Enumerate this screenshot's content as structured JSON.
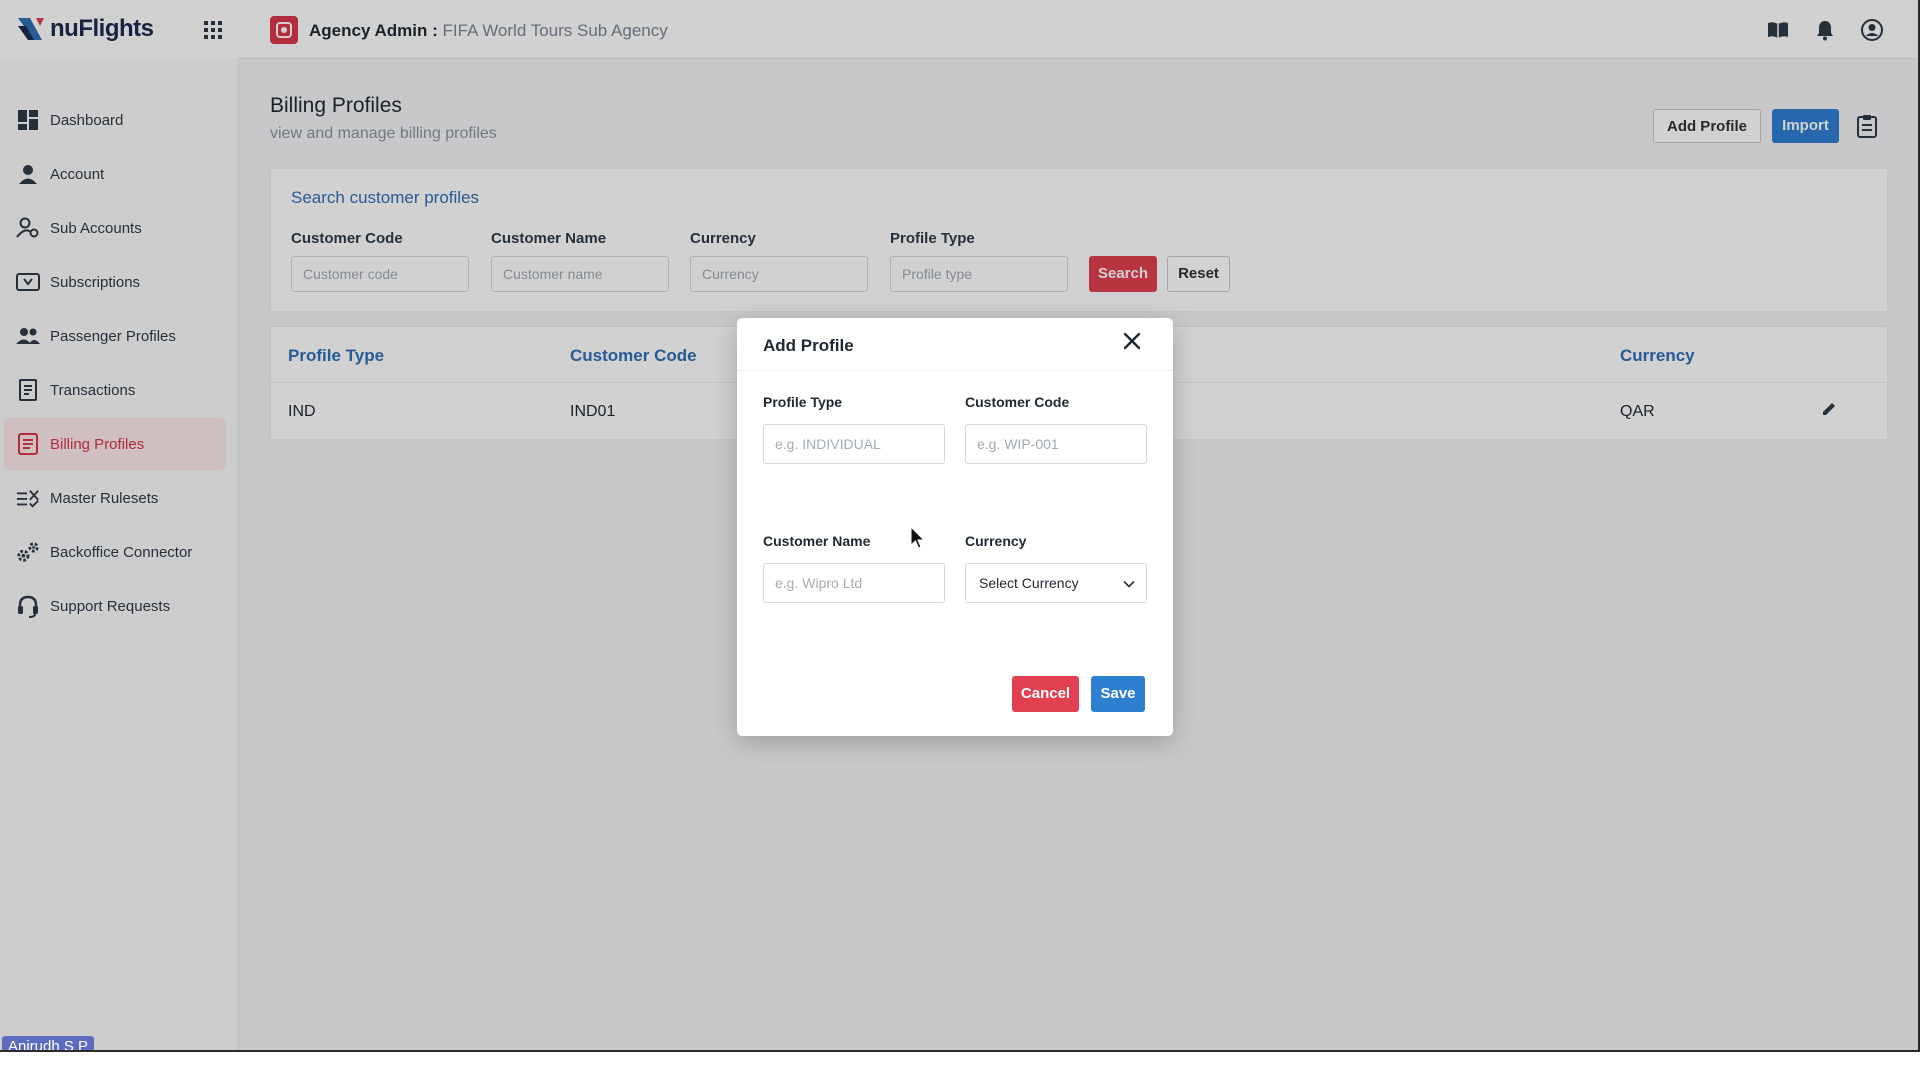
{
  "header": {
    "logo_text": "nuFlights",
    "agency_label": "Agency Admin :",
    "agency_name": "FIFA World Tours Sub Agency"
  },
  "sidebar": {
    "items": [
      {
        "label": "Dashboard",
        "icon": "dashboard-icon"
      },
      {
        "label": "Account",
        "icon": "person-icon"
      },
      {
        "label": "Sub Accounts",
        "icon": "user-gear-icon"
      },
      {
        "label": "Subscriptions",
        "icon": "ticket-icon"
      },
      {
        "label": "Passenger Profiles",
        "icon": "people-icon"
      },
      {
        "label": "Transactions",
        "icon": "receipt-icon"
      },
      {
        "label": "Billing Profiles",
        "icon": "billing-icon",
        "active": true
      },
      {
        "label": "Master Rulesets",
        "icon": "rules-icon"
      },
      {
        "label": "Backoffice Connector",
        "icon": "gears-icon"
      },
      {
        "label": "Support Requests",
        "icon": "headset-icon"
      }
    ]
  },
  "page": {
    "title": "Billing Profiles",
    "subtitle": "view and manage billing profiles",
    "add_profile_label": "Add Profile",
    "import_label": "Import"
  },
  "search": {
    "title": "Search customer profiles",
    "fields": [
      {
        "label": "Customer Code",
        "placeholder": "Customer code"
      },
      {
        "label": "Customer Name",
        "placeholder": "Customer name"
      },
      {
        "label": "Currency",
        "placeholder": "Currency"
      },
      {
        "label": "Profile Type",
        "placeholder": "Profile type"
      }
    ],
    "search_label": "Search",
    "reset_label": "Reset"
  },
  "table": {
    "columns": [
      "Profile Type",
      "Customer Code",
      "Currency"
    ],
    "rows": [
      {
        "profile_type": "IND",
        "customer_code": "IND01",
        "currency": "QAR"
      }
    ]
  },
  "modal": {
    "title": "Add Profile",
    "profile_type_label": "Profile Type",
    "profile_type_placeholder": "e.g. INDIVIDUAL",
    "customer_code_label": "Customer Code",
    "customer_code_placeholder": "e.g. WIP-001",
    "customer_name_label": "Customer Name",
    "customer_name_placeholder": "e.g. Wipro Ltd",
    "currency_label": "Currency",
    "currency_value": "Select Currency",
    "cancel_label": "Cancel",
    "save_label": "Save"
  },
  "user_tag": "Anirudh S P",
  "colors": {
    "accent_red": "#e0404f",
    "accent_blue": "#2f7fd1",
    "link_blue": "#2f6fb8"
  }
}
